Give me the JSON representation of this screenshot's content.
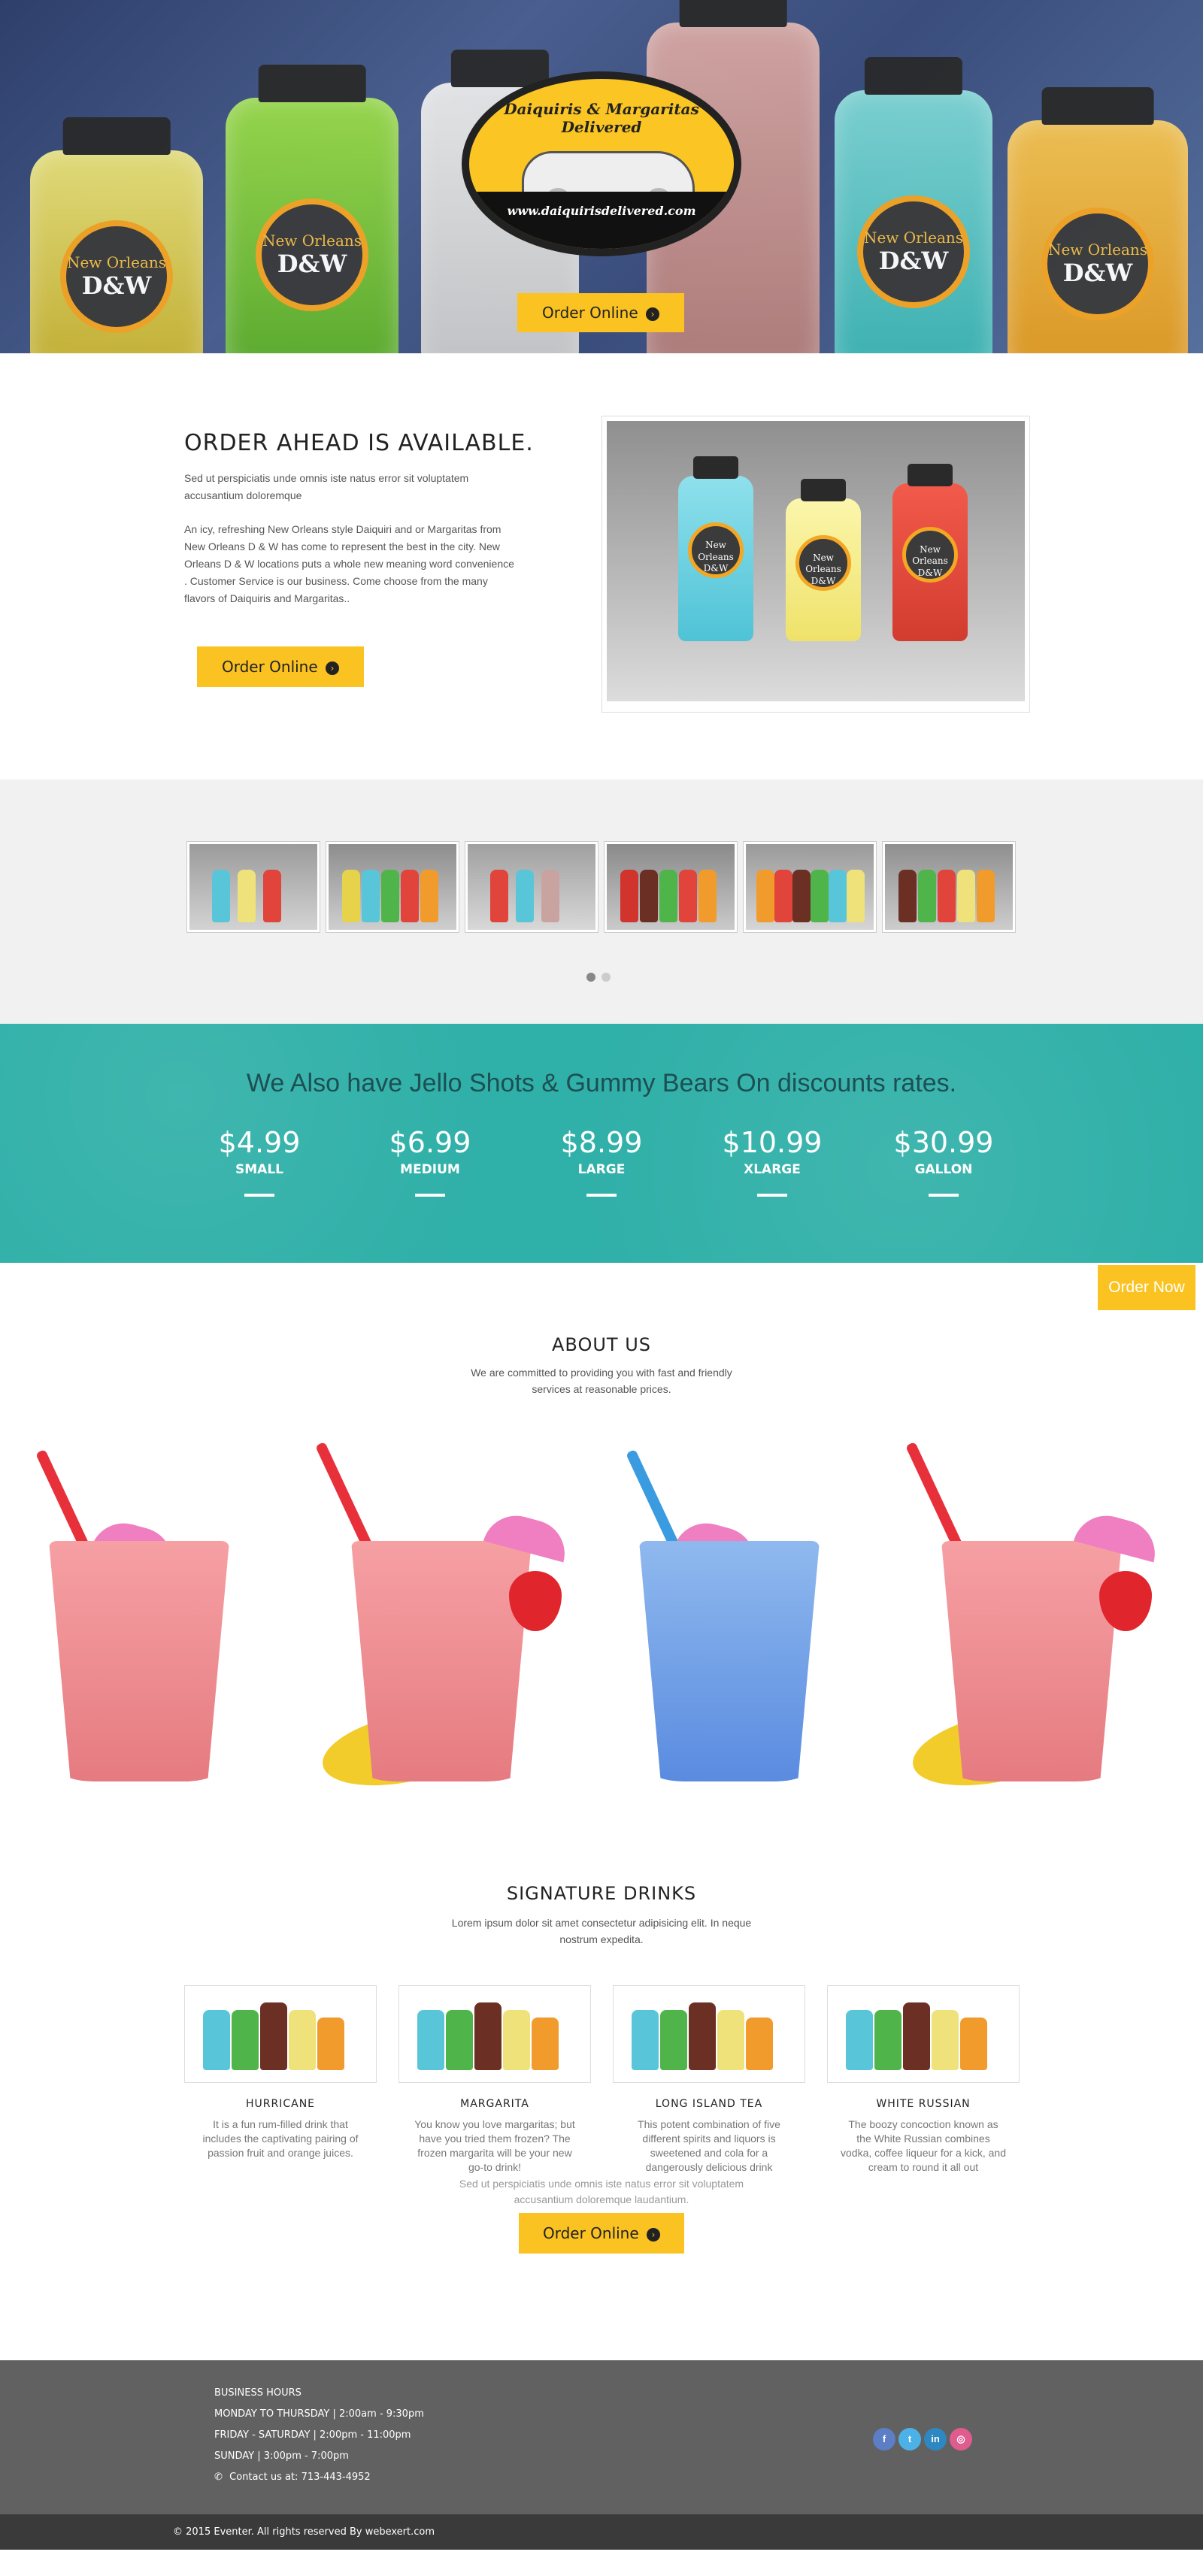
{
  "hero": {
    "bottle_label_top": "New Orleans",
    "bottle_label_bottom": "D&W",
    "logo_title": "Daiquiris & Margaritas Delivered",
    "logo_url": "www.daiquirisdelivered.com",
    "order_button": "Order Online"
  },
  "order_ahead": {
    "title": "ORDER AHEAD IS AVAILABLE.",
    "intro": "Sed ut perspiciatis unde omnis iste natus error sit voluptatem accusantium doloremque",
    "body": "An icy, refreshing New Orleans style Daiquiri and or Margaritas from New Orleans D & W has come to represent the best in the city. New Orleans D & W locations puts a whole new meaning word convenience . Customer Service is our business. Come choose from the many flavors of Daiquiris and Margaritas..",
    "order_button": "Order Online",
    "photo_label_top": "New Orleans",
    "photo_label_bottom": "D&W"
  },
  "pricing": {
    "title": "We Also have Jello Shots & Gummy Bears On discounts rates.",
    "items": [
      {
        "price": "$4.99",
        "size": "SMALL"
      },
      {
        "price": "$6.99",
        "size": "MEDIUM"
      },
      {
        "price": "$8.99",
        "size": "LARGE"
      },
      {
        "price": "$10.99",
        "size": "XLARGE"
      },
      {
        "price": "$30.99",
        "size": "GALLON"
      }
    ]
  },
  "float": {
    "order_now": "Order Now"
  },
  "about": {
    "title": "ABOUT US",
    "text": "We are committed to providing you with fast and friendly services at reasonable prices."
  },
  "signature": {
    "title": "SIGNATURE DRINKS",
    "lead": "Lorem ipsum dolor sit amet consectetur adipisicing elit. In neque nostrum expedita.",
    "drinks": [
      {
        "name": "HURRICANE",
        "desc": "It is a fun rum-filled drink that includes the captivating pairing of passion fruit and orange juices."
      },
      {
        "name": "MARGARITA",
        "desc": "You know you love margaritas; but have you tried them frozen? The frozen margarita will be your new go-to drink!"
      },
      {
        "name": "LONG ISLAND TEA",
        "desc": "This potent combination of five different spirits and liquors is sweetened and cola for a dangerously delicious drink"
      },
      {
        "name": "WHITE RUSSIAN",
        "desc": "The boozy concoction known as the White Russian combines vodka, coffee liqueur for a kick, and cream to round it all out"
      }
    ],
    "foot": "Sed ut perspiciatis unde omnis iste natus error sit voluptatem accusantium doloremque laudantium.",
    "order_button": "Order Online"
  },
  "footer": {
    "hours_title": "BUSINESS HOURS",
    "line1": "MONDAY TO THURSDAY | 2:00am - 9:30pm",
    "line2": "FRIDAY - SATURDAY | 2:00pm - 11:00pm",
    "line3": "SUNDAY | 3:00pm - 7:00pm",
    "contact": "Contact us at: 713-443-4952",
    "social": [
      {
        "icon": "facebook-icon",
        "glyph": "f",
        "color": "#5b7ec7"
      },
      {
        "icon": "twitter-icon",
        "glyph": "t",
        "color": "#4cb1e6"
      },
      {
        "icon": "linkedin-icon",
        "glyph": "in",
        "color": "#2d87c0"
      },
      {
        "icon": "instagram-icon",
        "glyph": "◎",
        "color": "#e05b8e"
      }
    ],
    "copyright": "© 2015 Eventer. All rights reserved By webexert.com"
  },
  "colors": {
    "accent": "#fbc321",
    "teal": "#2fb0a8",
    "footer": "#626161",
    "copyright_bar": "#3a3a3a"
  }
}
